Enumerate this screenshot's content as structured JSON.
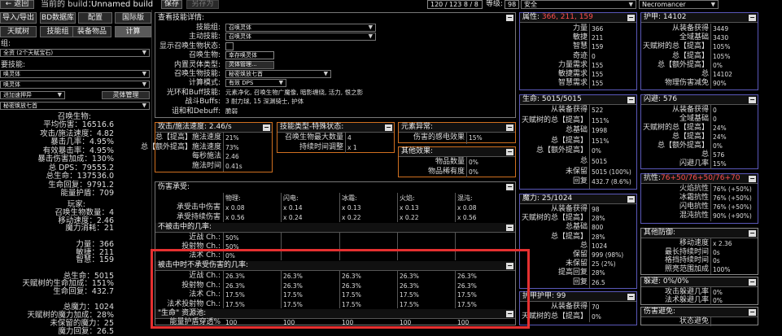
{
  "top": {
    "back": "← 返回",
    "build_label": "当前的 build：",
    "build_name": "Unnamed build",
    "save": "保存",
    "save_as": "另存为",
    "points": "120 / 123",
    "points2": "8 / 8",
    "level_label": "等级:",
    "level_value": "98",
    "class1": "安全",
    "class2": "Necromancer"
  },
  "nav": {
    "row1": [
      "导入/导出",
      "BD数据库",
      "配置",
      "国际版"
    ],
    "row2": [
      "天赋树",
      "技能组",
      "装备物品",
      "计算"
    ]
  },
  "left": {
    "label_a": "组:",
    "dd1": "全资 (2个天赋宝石)",
    "label_b": "要技能:",
    "dd2": "唤灵体",
    "dd3": "唤灵体",
    "dd4": "进加速押异",
    "skill_label": "灵体管理",
    "dd5": "秘密焕放七首",
    "minion_title": "召唤生物:",
    "minion_stats": [
      [
        "平均伤害",
        "16516.6"
      ],
      [
        "攻击/施法速度",
        "4.82"
      ],
      [
        "暴击几率",
        "4.95%"
      ],
      [
        "有效暴击率",
        "4.95%"
      ],
      [
        "暴击伤害加成",
        "130%"
      ],
      [
        "总 DPS",
        "79555.2"
      ],
      [
        "总生命",
        "137536.0"
      ],
      [
        "生命回复",
        "9791.2"
      ],
      [
        "能量护盾",
        "709"
      ]
    ],
    "player_title": "玩家:",
    "player_stats": [
      [
        "召唤生物数量",
        "4"
      ],
      [
        "移动速度",
        "2.46"
      ],
      [
        "魔力消耗",
        "21"
      ],
      [
        "",
        ""
      ],
      [
        "力量",
        "366"
      ],
      [
        "敏捷",
        "211"
      ],
      [
        "智慧",
        "159"
      ],
      [
        "",
        ""
      ],
      [
        "总生命",
        "5015"
      ],
      [
        "天赋树的生命加成",
        "151%"
      ],
      [
        "生命回复",
        "432.7"
      ],
      [
        "",
        ""
      ],
      [
        "总魔力",
        "1024"
      ],
      [
        "天赋树的魔力加成",
        "28%"
      ],
      [
        "未保留的魔力",
        "25"
      ],
      [
        "魔力回复",
        "26.5"
      ]
    ]
  },
  "details": {
    "title": "查看技能详情:",
    "rows": [
      [
        "技能组:",
        "召唤灵体"
      ],
      [
        "主动技能:",
        "召唤灵体"
      ],
      [
        "显示召唤生物状态:",
        ""
      ],
      [
        "召唤生物:",
        "幸存唤灵体"
      ],
      [
        "内置灵体类型:",
        "灵体管理..."
      ],
      [
        "召唤生物技能:",
        "秘密焕放七首"
      ],
      [
        "计算模式:",
        "有效 DPS"
      ],
      [
        "光环和Buff技能:",
        "元素净化, 召唤生物广魔像, 暗影缠绕, 活力, 恨之影"
      ],
      [
        "战斗Buffs:",
        "3 耐力球, 15 深渊骑士, 护体"
      ],
      [
        "诅和和Debuff:",
        "脆弱"
      ]
    ]
  },
  "attack": {
    "title": "攻击/施法速度: 2.46/s",
    "rows": [
      [
        "总【提高】施法速度",
        "21%"
      ],
      [
        "总【额外提高】施法速度",
        "73%"
      ],
      [
        "每秒施法",
        "2.46"
      ],
      [
        "施法时间",
        "0.41s"
      ]
    ]
  },
  "skilltype": {
    "title": "技能类型-特殊状态:",
    "rows": [
      [
        "召唤生物最大数量",
        "4"
      ],
      [
        "持续时间调整",
        "x 1"
      ]
    ]
  },
  "element": {
    "title": "元素异常:",
    "rows": [
      [
        "伤害的感电效果",
        "15%"
      ]
    ]
  },
  "other": {
    "title": "其他效果:",
    "rows": [
      [
        "物品数量",
        "0%"
      ],
      [
        "物品稀有度",
        "0%"
      ]
    ]
  },
  "damage_taken": {
    "title": "伤害承受:",
    "headers": [
      "物理:",
      "闪电:",
      "冰霜:",
      "火焰:",
      "混沌:"
    ],
    "rows": [
      [
        "承受击中伤害",
        [
          "x 0.08",
          "x 0.14",
          "x 0.13",
          "x 0.13",
          "x 0.08"
        ]
      ],
      [
        "承受持续伤害",
        [
          "x 0.56",
          "x 0.24",
          "x 0.22",
          "x 0.22",
          "x 0.56"
        ]
      ]
    ],
    "nohit_title": "不被击中的几率:",
    "nohit_rows": [
      [
        "近战 Ch.:",
        "50%"
      ],
      [
        "投射物 Ch.:",
        "50%"
      ],
      [
        "法术 Ch.:",
        "0%"
      ]
    ],
    "unhit_title": "被击中时不承受伤害的几率:",
    "unhit_rows": [
      [
        "近战 Ch.:",
        [
          "26.3%",
          "26.3%",
          "26.3%",
          "26.3%",
          "26.3%"
        ]
      ],
      [
        "投射物 Ch.:",
        [
          "26.3%",
          "26.3%",
          "26.3%",
          "26.3%",
          "26.3%"
        ]
      ],
      [
        "法术 Ch.:",
        [
          "17.5%",
          "17.5%",
          "17.5%",
          "17.5%",
          "17.5%"
        ]
      ],
      [
        "法术投射物 Ch.:",
        [
          "17.5%",
          "17.5%",
          "17.5%",
          "17.5%",
          "17.5%"
        ]
      ]
    ],
    "life_pool_title": "\"生命\" 资源池:",
    "life_pool_row": [
      "能量护盾穿透%",
      [
        "100",
        "100",
        "100",
        "100",
        "100"
      ]
    ]
  },
  "attributes": {
    "title": "属性: 366, 211, 159",
    "title_value": "366, 211, 159",
    "rows": [
      [
        "力量",
        "366"
      ],
      [
        "敏捷",
        "211"
      ],
      [
        "智慧",
        "159"
      ],
      [
        "奇迹",
        "0"
      ],
      [
        "力量需求",
        "155"
      ],
      [
        "敏捷需求",
        "155"
      ],
      [
        "智慧需求",
        "155"
      ]
    ]
  },
  "life": {
    "title": "生命: 5015/5015",
    "rows": [
      [
        "从装备获得",
        "522"
      ],
      [
        "天赋树的总【提高】",
        "151%"
      ],
      [
        "总基础",
        "1998"
      ],
      [
        "总【提高】",
        "151%"
      ],
      [
        "总【额外提高】",
        "0%"
      ],
      [
        "总",
        "5015"
      ],
      [
        "未保留",
        "5015 (100%)"
      ],
      [
        "回复",
        "432.7 (8.6%)"
      ]
    ]
  },
  "mana": {
    "title": "魔力: 25/1024",
    "rows": [
      [
        "从装备获得",
        "98"
      ],
      [
        "天赋树的总【提高】",
        "28%"
      ],
      [
        "总基础",
        "800"
      ],
      [
        "总【提高】",
        "28%"
      ],
      [
        "总",
        "1024"
      ],
      [
        "保留",
        "999 (98%)"
      ],
      [
        "未保留",
        "25 (2%)"
      ],
      [
        "提高回复",
        "28%"
      ],
      [
        "回复",
        "26.5"
      ]
    ]
  },
  "armour": {
    "title": "护甲护甲: 99",
    "rows": [
      [
        "从装备获得",
        "70"
      ],
      [
        "天赋树的总【提高】",
        "0%"
      ]
    ]
  },
  "armor_top": {
    "title": "护甲: 14102",
    "rows": [
      [
        "从装备获得",
        "3449"
      ],
      [
        "全域基础",
        "3430"
      ],
      [
        "天赋树的总【提高】",
        "105%"
      ],
      [
        "总【提高】",
        "105%"
      ],
      [
        "总【额外提高】",
        "0%"
      ],
      [
        "总",
        "14102"
      ],
      [
        "物理伤害减免",
        "90%"
      ]
    ]
  },
  "evasion": {
    "title": "闪避: 576",
    "rows": [
      [
        "从装备获得",
        "0"
      ],
      [
        "全域基础",
        "0"
      ],
      [
        "天赋树的总【提高】",
        "24%"
      ],
      [
        "总【提高】",
        "24%"
      ],
      [
        "总【额外提高】",
        "0%"
      ],
      [
        "总",
        "576"
      ],
      [
        "闪避几率",
        "15%"
      ]
    ]
  },
  "resist": {
    "title_prefix": "抗性: ",
    "title_value": "76+50/76+50/76+70",
    "rows": [
      [
        "火焰抗性",
        "76% (+50%)"
      ],
      [
        "冰霜抗性",
        "76% (+50%)"
      ],
      [
        "闪电抗性",
        "76% (+50%)"
      ],
      [
        "混沌抗性",
        "90% (+90%)"
      ]
    ]
  },
  "other_def": {
    "title": "其他防御:",
    "rows": [
      [
        "移动速度",
        "x 2.36"
      ],
      [
        "最长持续时间",
        "0s"
      ],
      [
        "格挡持续时间",
        "0s"
      ],
      [
        "照亮范围加成",
        "100%"
      ]
    ]
  },
  "dodge": {
    "title": "躲避: 0%/0%",
    "rows": [
      [
        "攻击躲避几率",
        "0%"
      ],
      [
        "法术躲避几率",
        "0%"
      ]
    ]
  },
  "avoid": {
    "title": "伤害避免:",
    "rows": [
      [
        "状态避免",
        ""
      ]
    ]
  },
  "colors": {
    "orange": "#d07020",
    "blue": "#5a58b8",
    "highlight": "#e53030",
    "red": "#ff5050"
  }
}
